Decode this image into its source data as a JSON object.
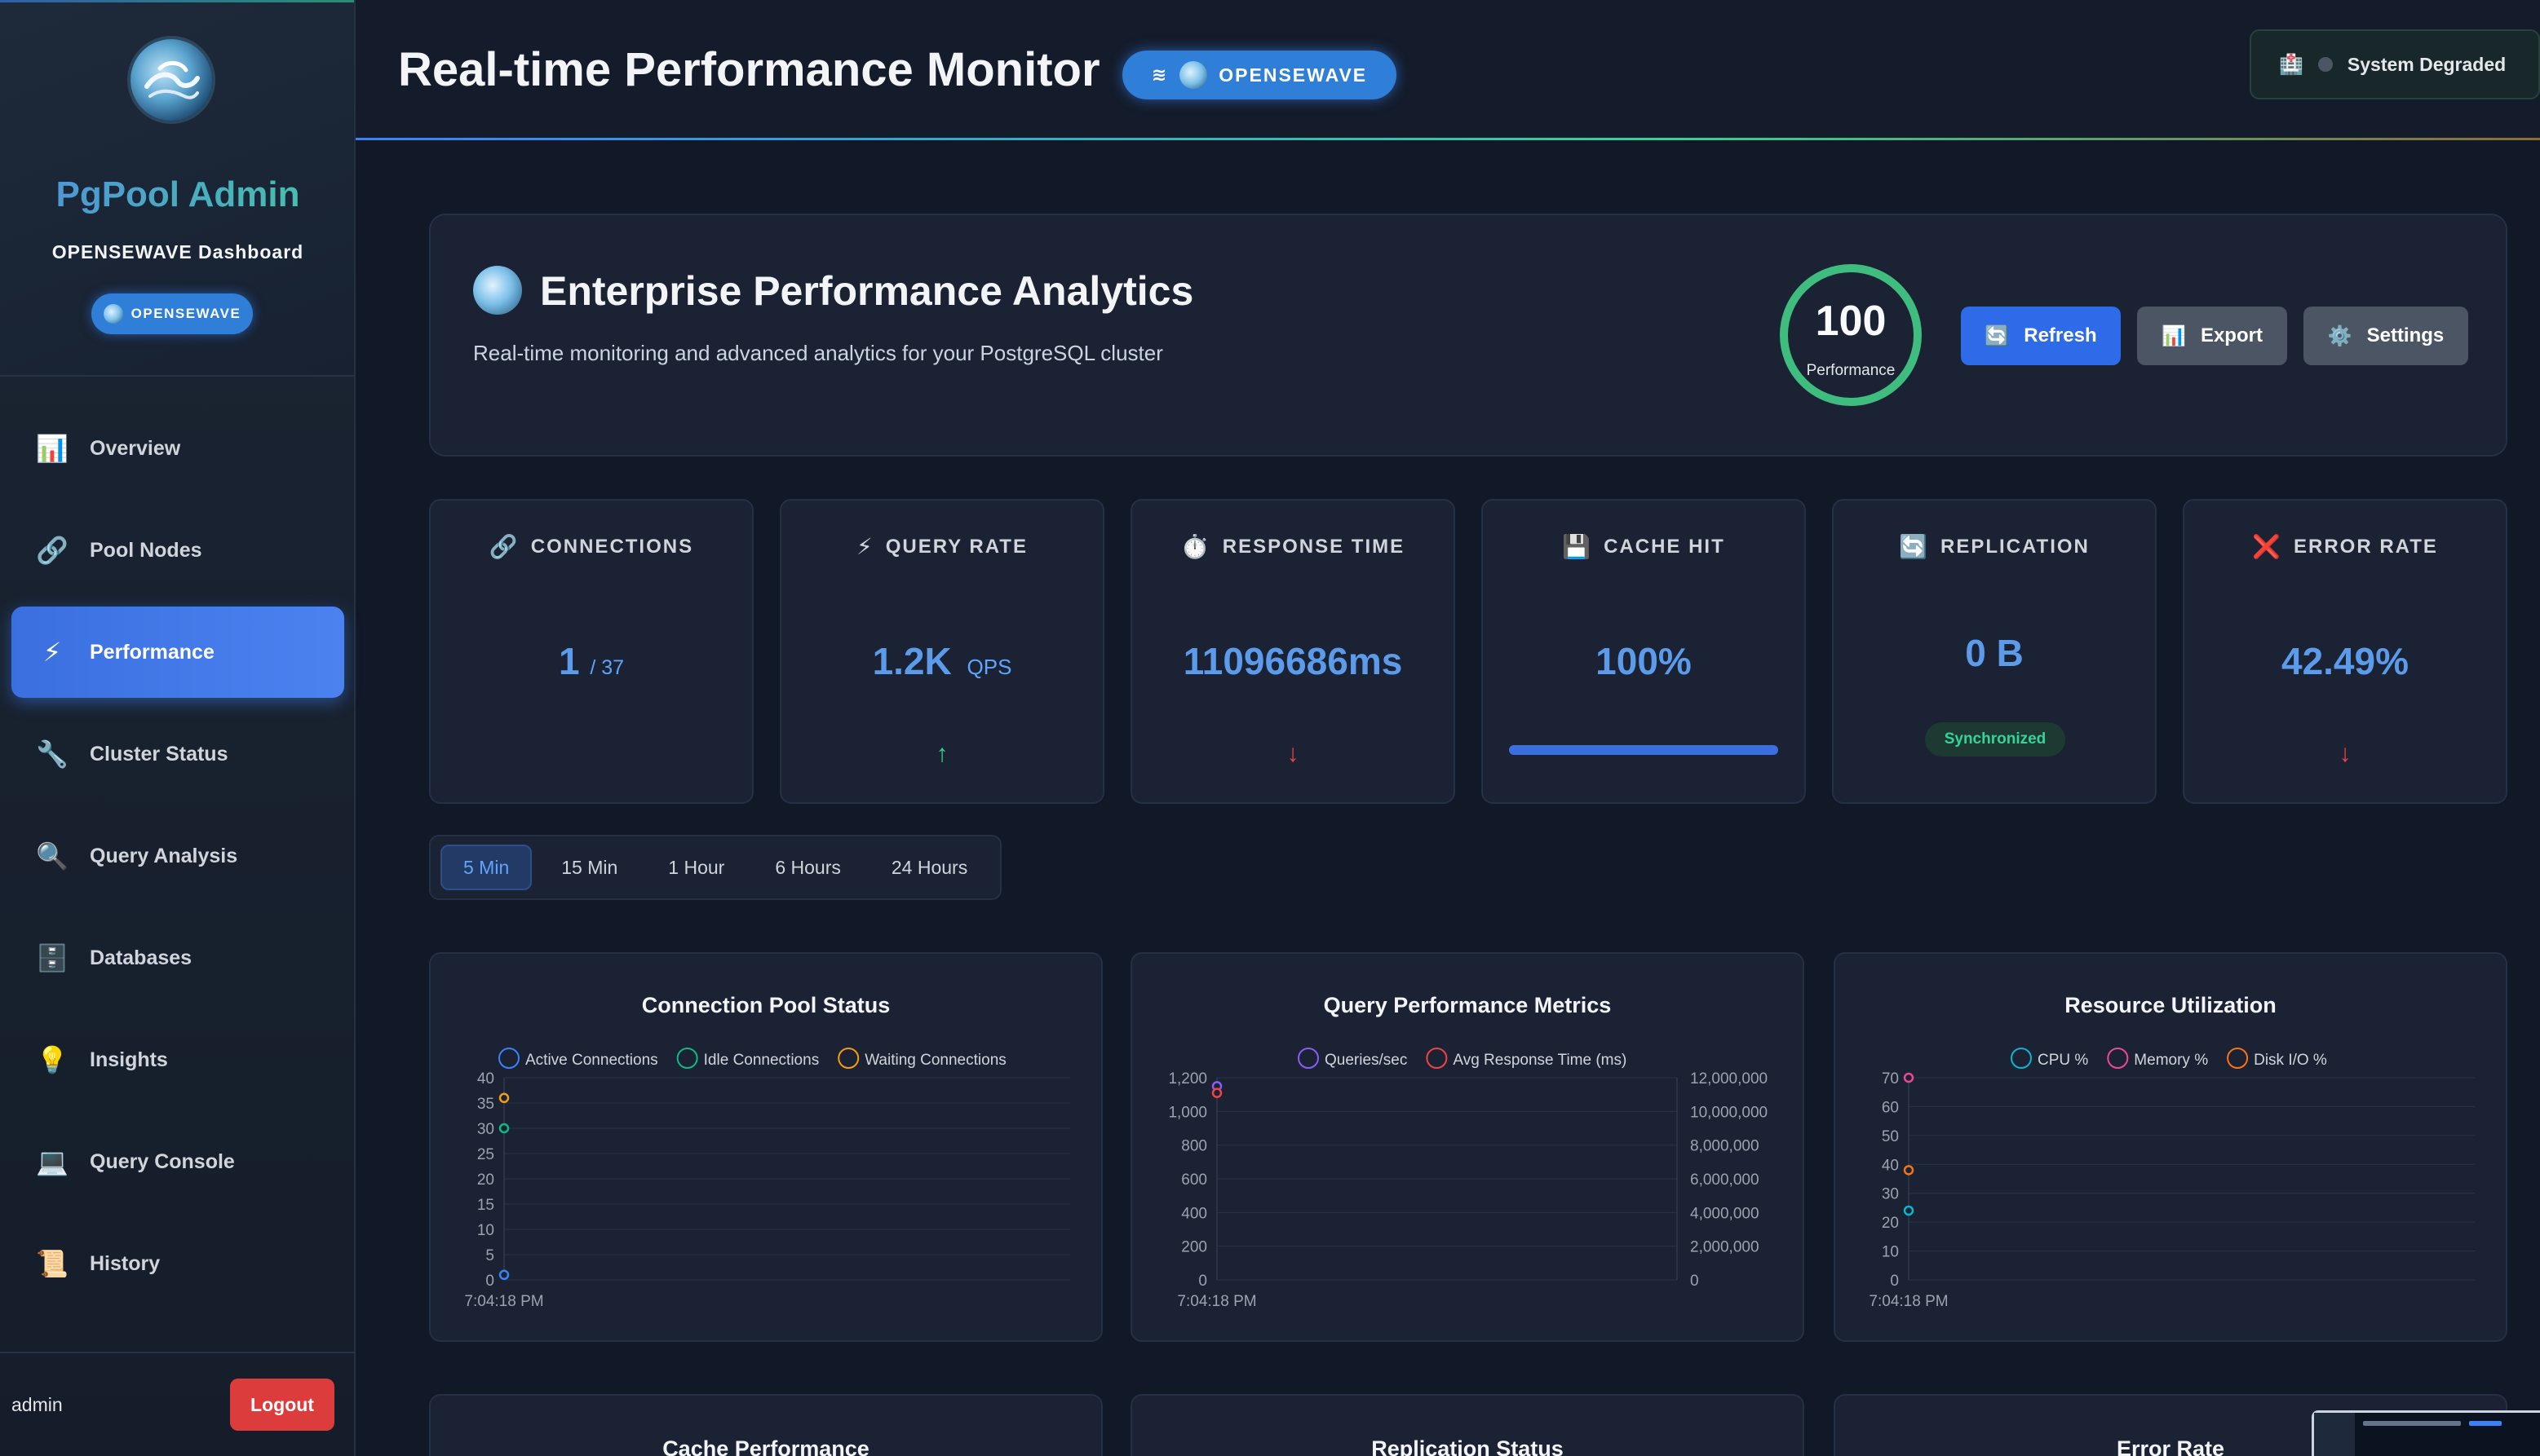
{
  "sidebar": {
    "brand": "PgPool Admin",
    "subtitle": "OPENSEWAVE Dashboard",
    "badge": "OPENSEWAVE",
    "items": [
      {
        "label": "Overview",
        "icon": "📊"
      },
      {
        "label": "Pool Nodes",
        "icon": "🔗"
      },
      {
        "label": "Performance",
        "icon": "⚡"
      },
      {
        "label": "Cluster Status",
        "icon": "🔧"
      },
      {
        "label": "Query Analysis",
        "icon": "🔍"
      },
      {
        "label": "Databases",
        "icon": "🗄️"
      },
      {
        "label": "Insights",
        "icon": "💡"
      },
      {
        "label": "Query Console",
        "icon": "💻"
      },
      {
        "label": "History",
        "icon": "📜"
      }
    ],
    "active_item": "Performance",
    "user": "admin",
    "logout_label": "Logout"
  },
  "header": {
    "title": "Real-time Performance Monitor",
    "badge": "OPENSEWAVE",
    "status": "System Degraded"
  },
  "hero": {
    "title": "Enterprise Performance Analytics",
    "subtitle": "Real-time monitoring and advanced analytics for your PostgreSQL cluster",
    "score": "100",
    "score_label": "Performance",
    "refresh_label": "Refresh",
    "export_label": "Export",
    "settings_label": "Settings"
  },
  "metrics": {
    "connections": {
      "label": "CONNECTIONS",
      "value": "1",
      "suffix": "/ 37"
    },
    "query_rate": {
      "label": "QUERY RATE",
      "value": "1.2K",
      "unit": "QPS",
      "trend": "↑"
    },
    "response_time": {
      "label": "RESPONSE TIME",
      "value": "11096686ms",
      "trend": "↓"
    },
    "cache_hit": {
      "label": "CACHE HIT",
      "value": "100%",
      "fill": 1.0
    },
    "replication": {
      "label": "REPLICATION",
      "value": "0 B",
      "status": "Synchronized"
    },
    "error_rate": {
      "label": "ERROR RATE",
      "value": "42.49%",
      "trend": "↓"
    }
  },
  "time_ranges": [
    "5 Min",
    "15 Min",
    "1 Hour",
    "6 Hours",
    "24 Hours"
  ],
  "time_range_active": "5 Min",
  "colors": {
    "accent": "#3b82f6",
    "success": "#34d399",
    "danger": "#ef4444",
    "warning": "#f59e0b",
    "purple": "#8b5cf6",
    "pink": "#ec4899",
    "cyan": "#06b6d4",
    "orange": "#f97316"
  },
  "chart_data": [
    {
      "type": "line",
      "title": "Connection Pool Status",
      "x": [
        "7:04:18 PM"
      ],
      "series": [
        {
          "name": "Active Connections",
          "values": [
            1
          ],
          "color": "#3b82f6"
        },
        {
          "name": "Idle Connections",
          "values": [
            30
          ],
          "color": "#10b981"
        },
        {
          "name": "Waiting Connections",
          "values": [
            36
          ],
          "color": "#f59e0b"
        }
      ],
      "ylim": [
        0,
        40
      ],
      "yticks": [
        0,
        5,
        10,
        15,
        20,
        25,
        30,
        35,
        40
      ],
      "legend": "top",
      "grid": true
    },
    {
      "type": "line",
      "title": "Query Performance Metrics",
      "x": [
        "7:04:18 PM"
      ],
      "series": [
        {
          "name": "Queries/sec",
          "values": [
            1150
          ],
          "color": "#8b5cf6",
          "axis": "left"
        },
        {
          "name": "Avg Response Time (ms)",
          "values": [
            11096686
          ],
          "color": "#ef4444",
          "axis": "right"
        }
      ],
      "ylim": [
        0,
        1200
      ],
      "yticks": [
        0,
        200,
        400,
        600,
        800,
        1000,
        1200
      ],
      "yticks_labels": [
        "0",
        "200",
        "400",
        "600",
        "800",
        "1,000",
        "1,200"
      ],
      "y2lim": [
        0,
        12000000
      ],
      "y2ticks_labels": [
        "0",
        "2,000,000",
        "4,000,000",
        "6,000,000",
        "8,000,000",
        "10,000,000",
        "12,000,000"
      ],
      "legend": "top",
      "grid": true
    },
    {
      "type": "line",
      "title": "Resource Utilization",
      "x": [
        "7:04:18 PM"
      ],
      "series": [
        {
          "name": "CPU %",
          "values": [
            24
          ],
          "color": "#06b6d4"
        },
        {
          "name": "Memory %",
          "values": [
            70
          ],
          "color": "#ec4899"
        },
        {
          "name": "Disk I/O %",
          "values": [
            38
          ],
          "color": "#f97316"
        }
      ],
      "ylim": [
        0,
        70
      ],
      "yticks": [
        0,
        10,
        20,
        30,
        40,
        50,
        60,
        70
      ],
      "legend": "top",
      "grid": true
    }
  ],
  "bottom_cards": [
    "Cache Performance",
    "Replication Status",
    "Error Rate"
  ]
}
